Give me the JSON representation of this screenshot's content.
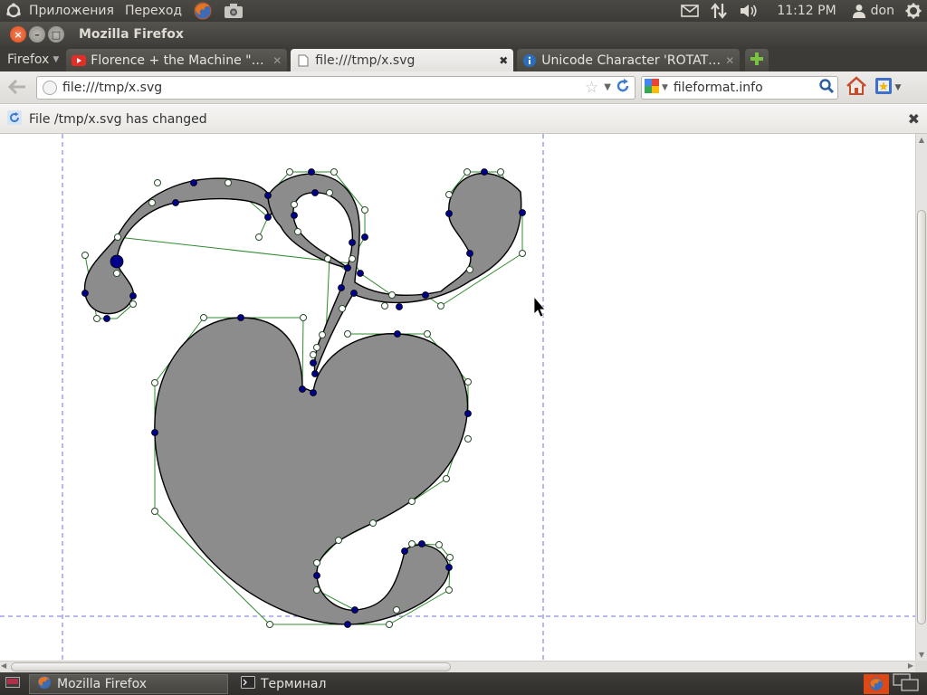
{
  "panel": {
    "menu_apps": "Приложения",
    "menu_go": "Переход",
    "clock": "11:12 PM",
    "user": "don"
  },
  "window": {
    "title": "Mozilla Firefox"
  },
  "firefox_menu": "Firefox",
  "tabs": [
    {
      "label": "Florence + the Machine \"Sh...",
      "icon": "youtube-icon"
    },
    {
      "label": "file:///tmp/x.svg",
      "icon": "blank-page-icon"
    },
    {
      "label": "Unicode Character 'ROTATE...",
      "icon": "info-icon"
    }
  ],
  "nav": {
    "url": "file:///tmp/x.svg",
    "search_value": "fileformat.info"
  },
  "notification": {
    "text": "File /tmp/x.svg has changed"
  },
  "taskbar": {
    "items": [
      {
        "label": "Mozilla Firefox"
      },
      {
        "label": "Терминал"
      }
    ]
  },
  "colors": {
    "shape_fill": "#8c8c8c",
    "node_color": "#00008b",
    "guide_color": "#7070dd",
    "handle_line": "#2e8b2e",
    "ubuntu_orange": "#dd4814"
  }
}
